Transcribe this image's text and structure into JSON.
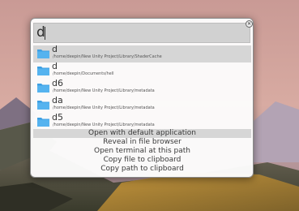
{
  "search": {
    "query": "d",
    "close_icon": "close-icon"
  },
  "results": [
    {
      "title": "d",
      "path": "/home/deepin/New Unity Project/Library/ShaderCache",
      "icon": "folder-icon"
    },
    {
      "title": "d",
      "path": "/home/deepin/Documents/hell",
      "icon": "folder-icon"
    },
    {
      "title": "d6",
      "path": "/home/deepin/New Unity Project/Library/metadata",
      "icon": "folder-icon"
    },
    {
      "title": "da",
      "path": "/home/deepin/New Unity Project/Library/metadata",
      "icon": "folder-icon"
    },
    {
      "title": "d5",
      "path": "/home/deepin/New Unity Project/Library/metadata",
      "icon": "folder-icon"
    }
  ],
  "actions": [
    "Open with default application",
    "Reveal in file browser",
    "Open terminal at this path",
    "Copy file to clipboard",
    "Copy path to clipboard"
  ],
  "colors": {
    "folder": "#3d9fe3",
    "selection": "#d6d6d6"
  }
}
